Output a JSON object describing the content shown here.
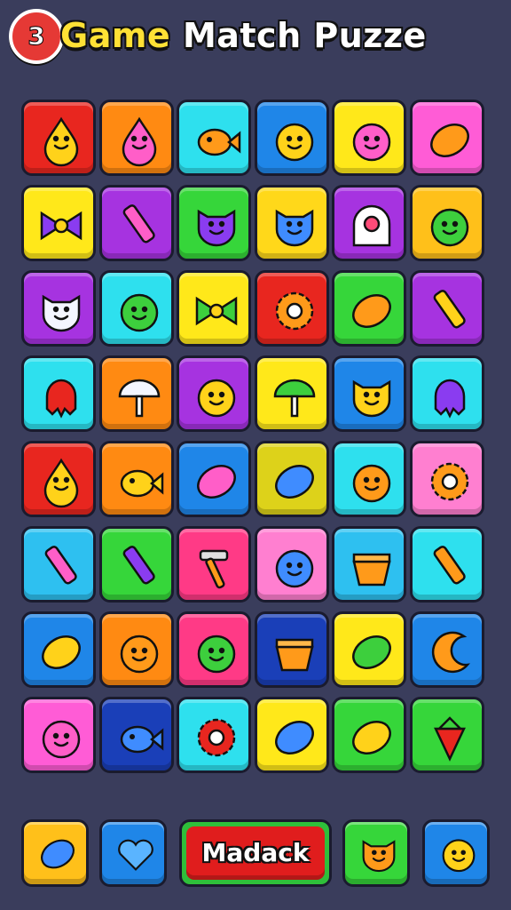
{
  "header": {
    "badge_text": "3",
    "title_word1": "Game",
    "title_rest": "Match Puzze"
  },
  "board": {
    "rows": [
      [
        {
          "bg": "#e8261f",
          "icon": "yellow-drop-face"
        },
        {
          "bg": "#ff8a12",
          "icon": "pink-drop-face"
        },
        {
          "bg": "#2ee0ee",
          "icon": "orange-fish"
        },
        {
          "bg": "#1f86e8",
          "icon": "yellow-face"
        },
        {
          "bg": "#ffe81a",
          "icon": "pink-face-ring"
        },
        {
          "bg": "#ff5cd6",
          "icon": "orange-carrot"
        }
      ],
      [
        {
          "bg": "#ffe81a",
          "icon": "purple-bow"
        },
        {
          "bg": "#a633e0",
          "icon": "pink-marker"
        },
        {
          "bg": "#36d63a",
          "icon": "purple-cat-face"
        },
        {
          "bg": "#ffd81a",
          "icon": "blue-bear-face"
        },
        {
          "bg": "#a633e0",
          "icon": "pink-arch"
        },
        {
          "bg": "#ffc01a",
          "icon": "green-germ-face"
        }
      ],
      [
        {
          "bg": "#a633e0",
          "icon": "white-cat-face"
        },
        {
          "bg": "#2ee0ee",
          "icon": "green-face"
        },
        {
          "bg": "#ffe81a",
          "icon": "green-bow"
        },
        {
          "bg": "#e8261f",
          "icon": "orange-gear"
        },
        {
          "bg": "#36d63a",
          "icon": "orange-leaf"
        },
        {
          "bg": "#a633e0",
          "icon": "yellow-pencil"
        }
      ],
      [
        {
          "bg": "#2ee0ee",
          "icon": "red-squid"
        },
        {
          "bg": "#ff8a12",
          "icon": "white-mushroom"
        },
        {
          "bg": "#a633e0",
          "icon": "yellow-face-laugh"
        },
        {
          "bg": "#ffe81a",
          "icon": "green-umbrella"
        },
        {
          "bg": "#1f86e8",
          "icon": "yellow-cat-face"
        },
        {
          "bg": "#2ee0ee",
          "icon": "purple-squid"
        }
      ],
      [
        {
          "bg": "#e8261f",
          "icon": "yellow-drop-face"
        },
        {
          "bg": "#ff8a12",
          "icon": "yellow-fish"
        },
        {
          "bg": "#1f86e8",
          "icon": "pink-candy"
        },
        {
          "bg": "#ddd21a",
          "icon": "blue-larva"
        },
        {
          "bg": "#2ee0ee",
          "icon": "orange-chick"
        },
        {
          "bg": "#ff7fd0",
          "icon": "orange-gear"
        }
      ],
      [
        {
          "bg": "#2ec0f0",
          "icon": "pink-marker"
        },
        {
          "bg": "#36d63a",
          "icon": "purple-pencil"
        },
        {
          "bg": "#ff3a86",
          "icon": "orange-hammer"
        },
        {
          "bg": "#ff7fd0",
          "icon": "blue-skull-face"
        },
        {
          "bg": "#2ec0f0",
          "icon": "orange-box"
        },
        {
          "bg": "#2ee0ee",
          "icon": "orange-bottle"
        }
      ],
      [
        {
          "bg": "#1f86e8",
          "icon": "yellow-lemon"
        },
        {
          "bg": "#ff8a12",
          "icon": "orange-face-cap"
        },
        {
          "bg": "#ff3a86",
          "icon": "green-face"
        },
        {
          "bg": "#1a3fb8",
          "icon": "orange-basket"
        },
        {
          "bg": "#ffe81a",
          "icon": "green-leaves"
        },
        {
          "bg": "#1f86e8",
          "icon": "orange-crescent"
        }
      ],
      [
        {
          "bg": "#ff5cd6",
          "icon": "pink-face"
        },
        {
          "bg": "#1a3fb8",
          "icon": "blue-fish"
        },
        {
          "bg": "#2ee0ee",
          "icon": "red-flower"
        },
        {
          "bg": "#ffe81a",
          "icon": "blue-leaf"
        },
        {
          "bg": "#36d63a",
          "icon": "yellow-lemon"
        },
        {
          "bg": "#36d63a",
          "icon": "red-strawberry"
        }
      ]
    ]
  },
  "bottom_bar": {
    "left_buttons": [
      {
        "bg": "#ffc01a",
        "icon": "blue-blob"
      },
      {
        "bg": "#1f86e8",
        "icon": "blue-heart"
      }
    ],
    "main_button_label": "Madack",
    "right_buttons": [
      {
        "bg": "#36d63a",
        "icon": "orange-cat-face"
      },
      {
        "bg": "#1f86e8",
        "icon": "yellow-coin-face"
      }
    ]
  }
}
